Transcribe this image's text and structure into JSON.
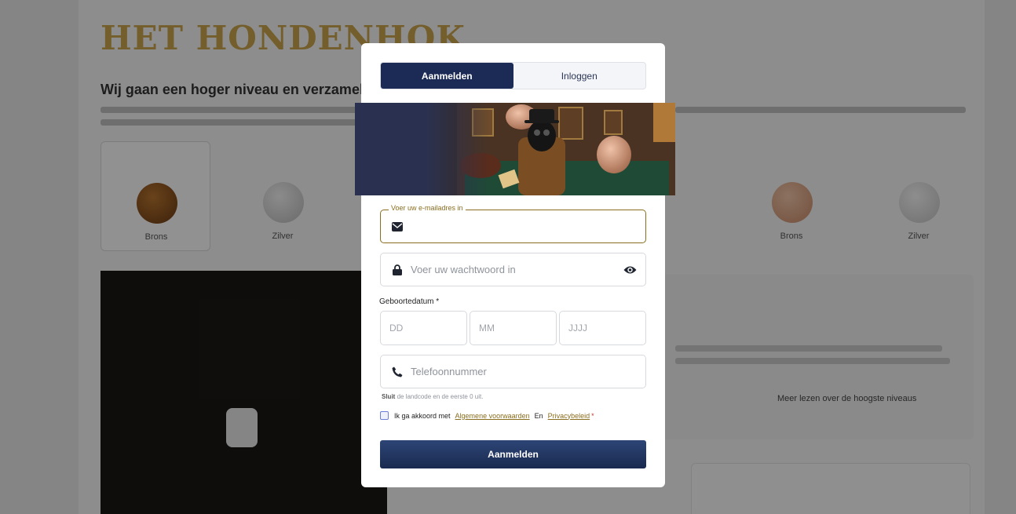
{
  "background": {
    "logo_text": "HET HONDENHOK",
    "heading": "Wij gaan een hoger niveau en verzamel",
    "medals": [
      {
        "label": "Brons",
        "color": "#8a4f1d"
      },
      {
        "label": "Zilver",
        "color": "#c9c9c9"
      },
      {
        "label": "Brons",
        "color": "#d6a07f"
      },
      {
        "label": "Zilver",
        "color": "#d4d4d4"
      }
    ],
    "right_text": "Meer lezen over de hoogste niveaus"
  },
  "modal": {
    "tabs": [
      {
        "label": "Aanmelden",
        "active": true
      },
      {
        "label": "Inloggen",
        "active": false
      }
    ],
    "email": {
      "label": "Voer uw e-mailadres in",
      "value": "",
      "icon": "envelope-icon"
    },
    "password": {
      "placeholder": "Voer uw wachtwoord in",
      "icon": "lock-icon",
      "toggle_icon": "eye-icon"
    },
    "dob": {
      "label": "Geboortedatum *",
      "day_placeholder": "DD",
      "month_placeholder": "MM",
      "year_placeholder": "JJJJ"
    },
    "phone": {
      "placeholder": "Telefoonnummer",
      "icon": "phone-icon"
    },
    "phone_hint": {
      "bold": "Sluit",
      "rest": " de landcode en de eerste 0 uit."
    },
    "consent": {
      "prefix": "Ik ga akkoord met",
      "terms_link": "Algemene voorwaarden",
      "conjunction": "En",
      "privacy_link": "Privacybeleid",
      "required_mark": "*",
      "checked": false
    },
    "submit_label": "Aanmelden",
    "colors": {
      "primary": "#1b2b55",
      "accent": "#8a6d1e"
    }
  }
}
